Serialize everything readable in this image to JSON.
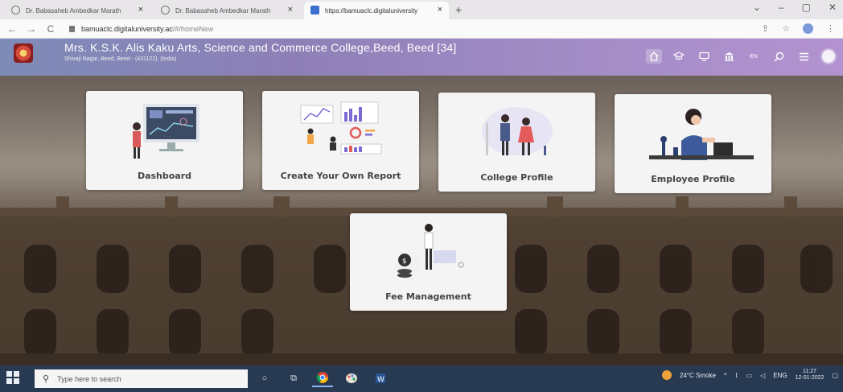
{
  "browser": {
    "tabs": [
      {
        "title": "Dr. Babasaheb Ambedkar Marath",
        "active": false
      },
      {
        "title": "Dr. Babasaheb Ambedkar Marath",
        "active": false
      },
      {
        "title": "https://bamuaclc.digitaluniversity",
        "active": true
      }
    ],
    "new_tab": "+",
    "close_glyph": "×",
    "url_host": "bamuaclc.digitaluniversity.ac",
    "url_path": "/#/homeNew",
    "nav": {
      "back": "←",
      "forward": "→",
      "reload": "C"
    },
    "window": {
      "dropdown": "⌄",
      "minimize": "–",
      "maximize": "▢",
      "close": "✕"
    }
  },
  "header": {
    "college_name": "Mrs. K.S.K. Alis Kaku Arts, Science and Commerce College,Beed, Beed [34]",
    "college_address": "Shivaji Nagar, Beed, Beed - (431122), (India)",
    "language": "EN",
    "icons": [
      "home-icon",
      "graduation-cap-icon",
      "monitor-icon",
      "bank-icon",
      "search-icon",
      "menu-icon",
      "user-avatar"
    ]
  },
  "cards": {
    "dashboard": "Dashboard",
    "report": "Create Your Own Report",
    "college": "College Profile",
    "employee": "Employee Profile",
    "fee": "Fee Management"
  },
  "taskbar": {
    "search_placeholder": "Type here to search",
    "weather": "24°C  Smoke",
    "language": "ENG",
    "time": "11:27",
    "date": "12-01-2022"
  },
  "colors": {
    "header_gradient_start": "#7d8bb7",
    "header_gradient_end": "#b292cf",
    "taskbar": "#283a52",
    "card_bg": "#f4f4f4"
  }
}
